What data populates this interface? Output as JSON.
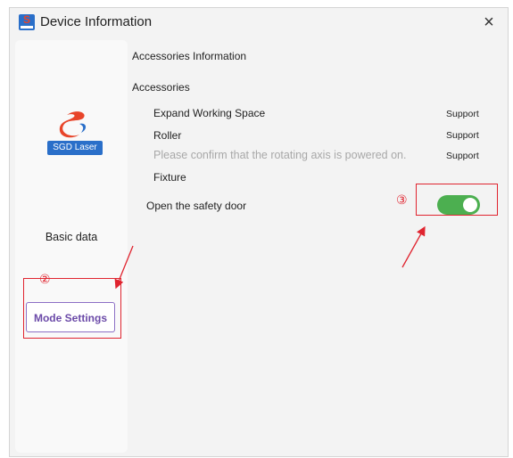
{
  "window": {
    "title": "Device Information",
    "close_glyph": "×"
  },
  "sidebar": {
    "brand_logo_text": "SGD Laser",
    "basic_data": "Basic data",
    "mode_settings": "Mode Settings"
  },
  "content": {
    "section_title": "Accessories Information",
    "subsection_title": "Accessories",
    "rows": [
      {
        "label": "Expand Working Space",
        "status": "Support"
      },
      {
        "label": "Roller",
        "status": "Support"
      },
      {
        "label": "Please confirm that the rotating axis is powered on.",
        "status": "Support"
      },
      {
        "label": "Fixture",
        "status": ""
      }
    ],
    "safety_door": {
      "label": "Open the safety door",
      "enabled": true
    }
  },
  "annotations": {
    "marker_2": "②",
    "marker_3": "③"
  },
  "colors": {
    "toggle_on": "#4caf50",
    "annotation": "#e0242f",
    "mode_accent": "#6b4aa8"
  }
}
